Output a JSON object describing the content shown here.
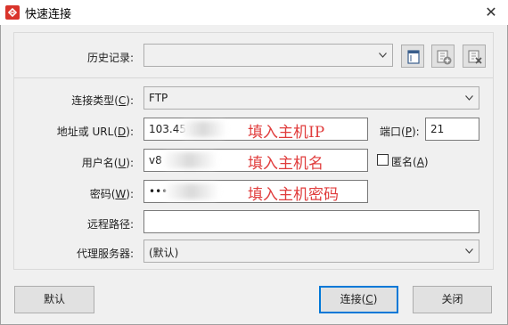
{
  "window": {
    "title": "快速连接",
    "close_glyph": "✕"
  },
  "history": {
    "label": "历史记录:",
    "value": ""
  },
  "connection_type": {
    "label_prefix": "连接类型(",
    "label_key": "C",
    "label_suffix": "):",
    "value": "FTP"
  },
  "address": {
    "label_prefix": "地址或 URL(",
    "label_key": "D",
    "label_suffix": "):",
    "value": "103.45",
    "hint": "填入主机IP"
  },
  "port": {
    "label_prefix": "端口(",
    "label_key": "P",
    "label_suffix": "):",
    "value": "21"
  },
  "username": {
    "label_prefix": "用户名(",
    "label_key": "U",
    "label_suffix": "):",
    "value": "v8",
    "hint": "填入主机名"
  },
  "anonymous": {
    "label_prefix": "匿名(",
    "label_key": "A",
    "label_suffix": ")",
    "checked": false
  },
  "password": {
    "label_prefix": "密码(",
    "label_key": "W",
    "label_suffix": "):",
    "value": "•••",
    "hint": "填入主机密码"
  },
  "remote_path": {
    "label": "远程路径:",
    "value": ""
  },
  "proxy": {
    "label": "代理服务器:",
    "value": "(默认)"
  },
  "buttons": {
    "default": "默认",
    "connect_prefix": "连接(",
    "connect_key": "C",
    "connect_suffix": ")",
    "close": "关闭"
  },
  "colors": {
    "hint": "#e03c3c",
    "accent": "#0078d7",
    "icon_red": "#d9342b"
  }
}
